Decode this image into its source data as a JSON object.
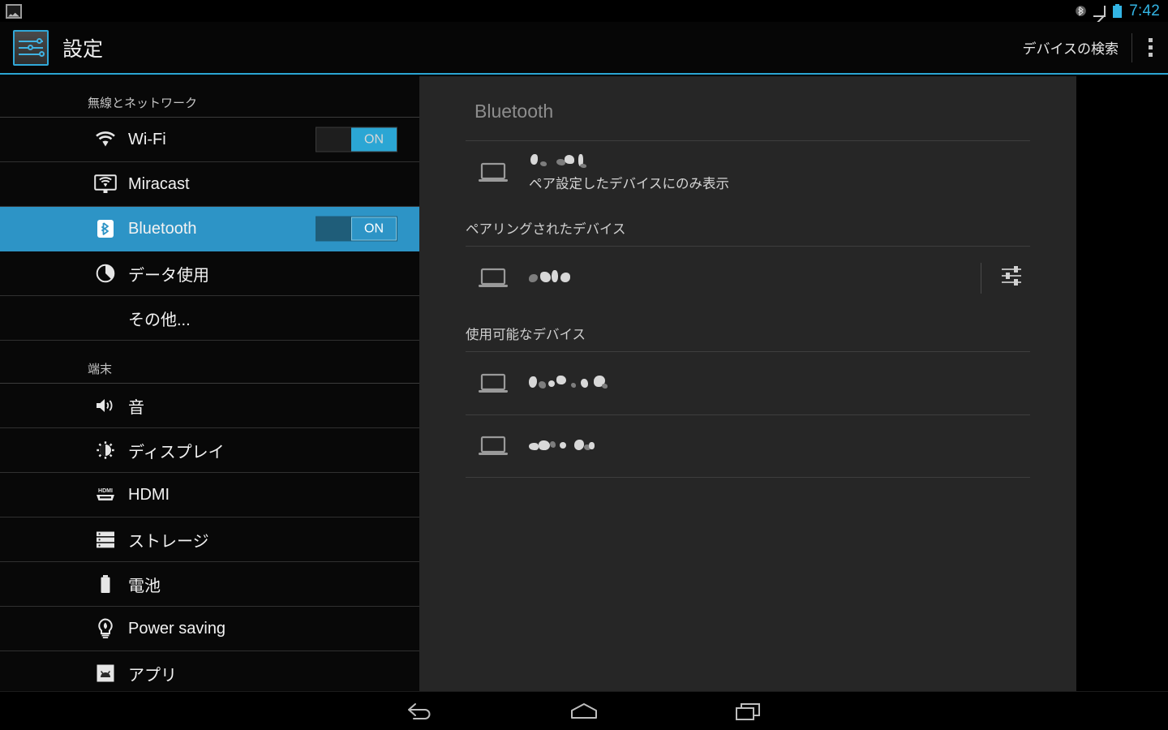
{
  "statusbar": {
    "notification_icon": "image-icon",
    "bluetooth_icon": "bluetooth-icon",
    "signal_icon": "signal-triangle-icon",
    "battery_icon": "battery-icon",
    "clock": "7:42",
    "accent_color": "#33b5e5"
  },
  "actionbar": {
    "app_icon": "settings-sliders-icon",
    "title": "設定",
    "action_label": "デバイスの検索",
    "overflow_icon": "overflow-menu-icon",
    "underline_color": "#2ba6d4"
  },
  "sidebar": {
    "sections": [
      {
        "header": "無線とネットワーク",
        "items": [
          {
            "label": "Wi-Fi",
            "icon": "wifi-icon",
            "toggle": "ON",
            "selected": false
          },
          {
            "label": "Miracast",
            "icon": "miracast-icon",
            "toggle": null,
            "selected": false
          },
          {
            "label": "Bluetooth",
            "icon": "bluetooth-icon",
            "toggle": "ON",
            "selected": true
          },
          {
            "label": "データ使用",
            "icon": "data-usage-icon",
            "toggle": null,
            "selected": false
          },
          {
            "label": "その他...",
            "icon": null,
            "toggle": null,
            "selected": false
          }
        ]
      },
      {
        "header": "端末",
        "items": [
          {
            "label": "音",
            "icon": "sound-icon",
            "toggle": null,
            "selected": false
          },
          {
            "label": "ディスプレイ",
            "icon": "display-icon",
            "toggle": null,
            "selected": false
          },
          {
            "label": "HDMI",
            "icon": "hdmi-icon",
            "toggle": null,
            "selected": false
          },
          {
            "label": "ストレージ",
            "icon": "storage-icon",
            "toggle": null,
            "selected": false
          },
          {
            "label": "電池",
            "icon": "battery-icon",
            "toggle": null,
            "selected": false
          },
          {
            "label": "Power saving",
            "icon": "power-saving-icon",
            "toggle": null,
            "selected": false
          },
          {
            "label": "アプリ",
            "icon": "apps-icon",
            "toggle": null,
            "selected": false
          }
        ]
      }
    ],
    "selected_color": "#2d94c6"
  },
  "panel": {
    "title": "Bluetooth",
    "local_device": {
      "icon": "laptop-icon",
      "name": "",
      "name_redacted": true,
      "subtitle": "ペア設定したデバイスにのみ表示"
    },
    "paired_section": {
      "header": "ペアリングされたデバイス",
      "devices": [
        {
          "icon": "laptop-icon",
          "name": "",
          "name_redacted": true,
          "settings_icon": "device-settings-icon"
        }
      ]
    },
    "available_section": {
      "header": "使用可能なデバイス",
      "devices": [
        {
          "icon": "laptop-icon",
          "name": "",
          "name_redacted": true
        },
        {
          "icon": "laptop-icon",
          "name": "",
          "name_redacted": true
        }
      ]
    }
  },
  "navbar": {
    "back": "back-icon",
    "home": "home-icon",
    "recents": "recents-icon"
  }
}
